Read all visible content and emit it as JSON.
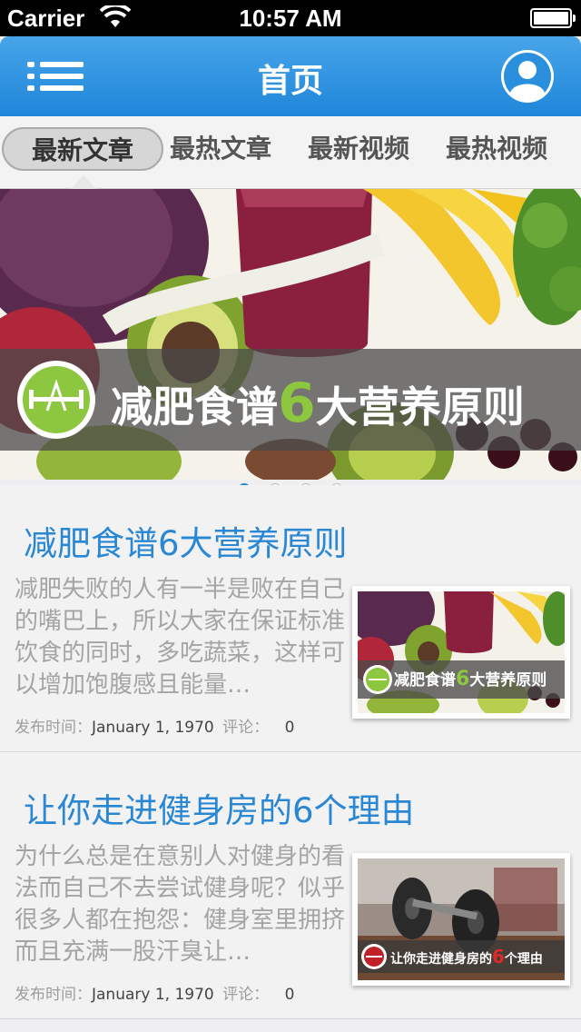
{
  "status_bar": {
    "carrier": "Carrier",
    "time": "10:57 AM"
  },
  "nav": {
    "title": "首页",
    "menu_icon": "menu-list-icon",
    "avatar_icon": "user-avatar-icon"
  },
  "tabs": [
    "最新文章",
    "最热文章",
    "最新视频",
    "最热视频"
  ],
  "banner": {
    "headline_prefix": "减肥食谱",
    "headline_number": "6",
    "headline_suffix": "大营养原则",
    "pages": 4,
    "active_page": 1
  },
  "articles": [
    {
      "title": "减肥食谱6大营养原则",
      "summary": "减肥失败的人有一半是败在自己的嘴巴上，所以大家在保证标准饮食的同时，多吃蔬菜，这样可以增加饱腹感且能量…",
      "meta_label": "发布时间：",
      "date": "January 1, 1970",
      "comments_label": "评论：",
      "comments": "0",
      "thumb_caption_prefix": "减肥食谱",
      "thumb_caption_number": "6",
      "thumb_caption_suffix": "大营养原则"
    },
    {
      "title": "让你走进健身房的6个理由",
      "summary": "为什么总是在意别人对健身的看法而自己不去尝试健身呢？似乎很多人都在抱怨：健身室里拥挤而且充满一股汗臭让…",
      "meta_label": "发布时间：",
      "date": "January 1, 1970",
      "comments_label": "评论：",
      "comments": "0",
      "thumb_caption_prefix": "让你走进健身房的",
      "thumb_caption_number": "6",
      "thumb_caption_suffix": "个理由"
    }
  ],
  "colors": {
    "nav_blue": "#1f86d9",
    "title_blue": "#2a87d4",
    "logo_green": "#8dc63f"
  }
}
